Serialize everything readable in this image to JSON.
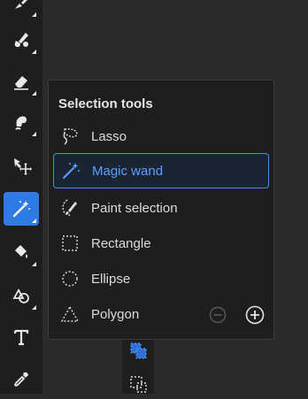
{
  "toolbar": {
    "tools": [
      {
        "name": "brush-tool",
        "icon": "brush-icon",
        "active": false
      },
      {
        "name": "fill-brush-tool",
        "icon": "paint-brush-icon",
        "active": false
      },
      {
        "name": "eraser-tool",
        "icon": "eraser-icon",
        "active": false
      },
      {
        "name": "smudge-tool",
        "icon": "smudge-icon",
        "active": false
      },
      {
        "name": "move-tool",
        "icon": "move-icon",
        "active": false
      },
      {
        "name": "magic-wand-tool",
        "icon": "magic-wand-icon",
        "active": true
      },
      {
        "name": "paint-bucket-tool",
        "icon": "paint-bucket-icon",
        "active": false
      },
      {
        "name": "shape-tool",
        "icon": "shapes-icon",
        "active": false
      },
      {
        "name": "type-tool",
        "icon": "type-icon",
        "active": false
      },
      {
        "name": "eyedropper-tool",
        "icon": "eyedropper-icon",
        "active": false
      }
    ]
  },
  "popover": {
    "title": "Selection tools",
    "items": [
      {
        "label": "Lasso",
        "icon": "lasso-icon",
        "selected": false
      },
      {
        "label": "Magic wand",
        "icon": "magic-wand-icon",
        "selected": true
      },
      {
        "label": "Paint selection",
        "icon": "paint-selection-icon",
        "selected": false
      },
      {
        "label": "Rectangle",
        "icon": "rectangle-select-icon",
        "selected": false
      },
      {
        "label": "Ellipse",
        "icon": "ellipse-select-icon",
        "selected": false
      },
      {
        "label": "Polygon",
        "icon": "polygon-select-icon",
        "selected": false
      }
    ],
    "polygon_controls": {
      "remove": "minus-circle-icon",
      "add": "plus-circle-icon"
    }
  },
  "colors": {
    "accent": "#2f7ae5",
    "selected_text": "#5aa0ff",
    "panel_bg": "#1e1e1e",
    "canvas_bg": "#2b2b2b"
  }
}
